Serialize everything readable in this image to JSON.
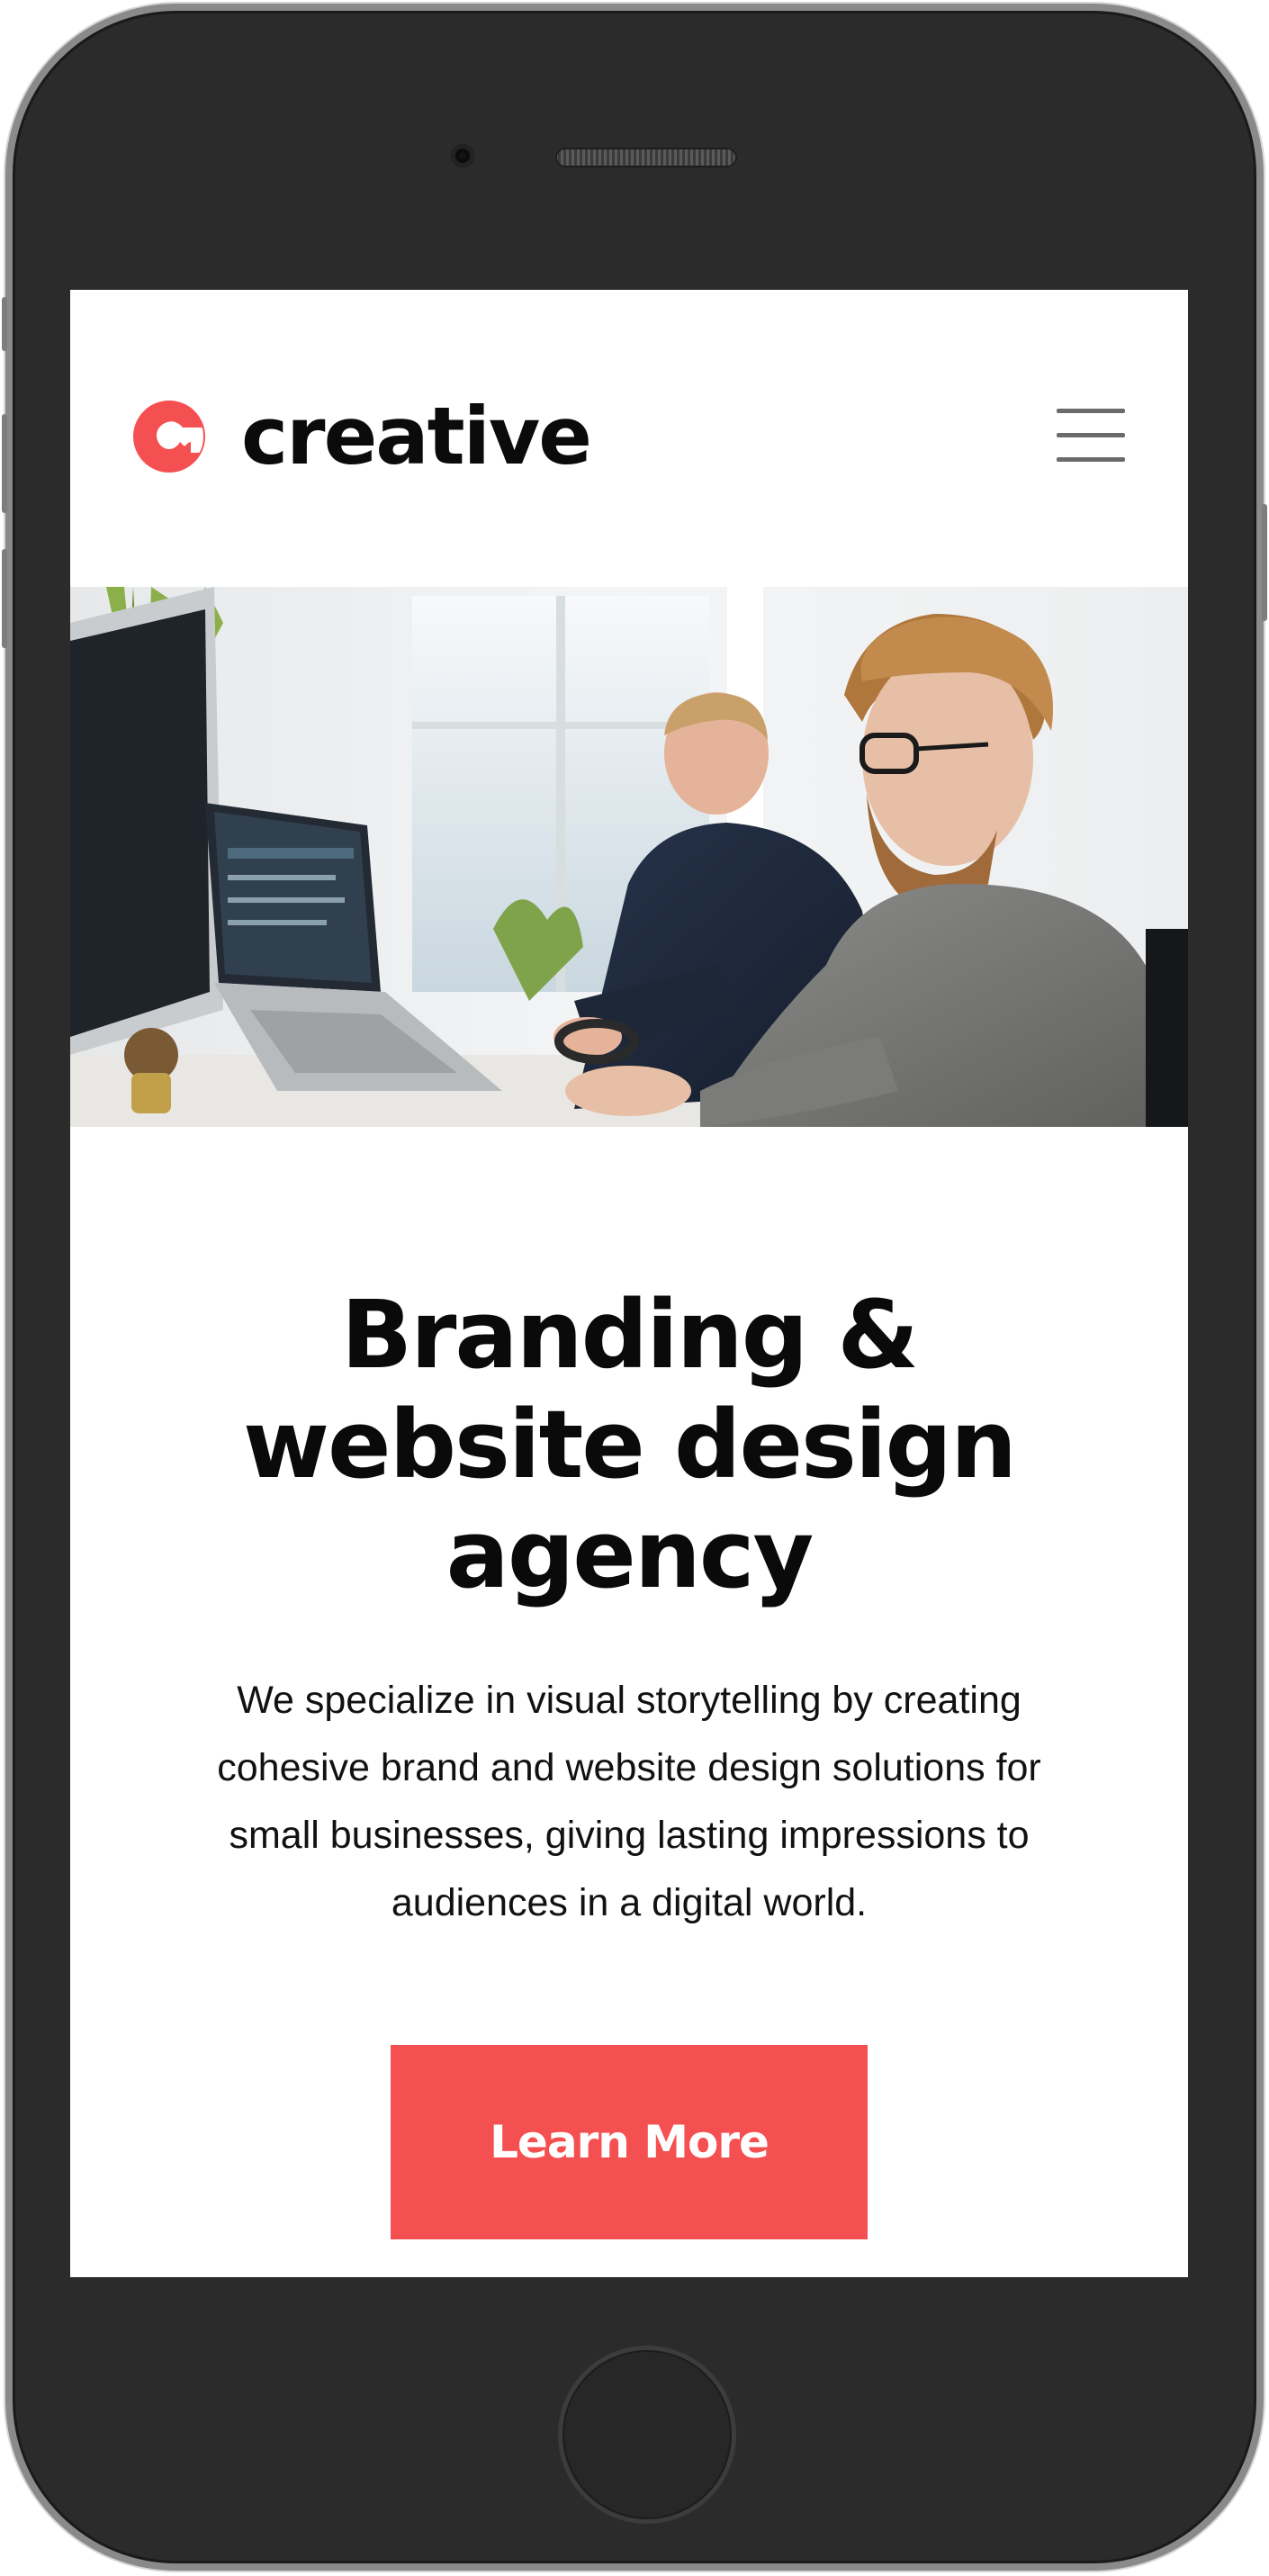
{
  "brand": {
    "name": "creative",
    "accent_color": "#f55051"
  },
  "header": {
    "logo_icon": "c-logo-icon",
    "menu_icon": "hamburger-menu-icon"
  },
  "hero": {
    "image": "office-workers-at-computers-photo"
  },
  "main": {
    "headline": "Branding & website design agency",
    "description": "We specialize in visual storytelling by creating cohesive brand and website design solutions for small businesses, giving lasting impressions to audiences in a digital world.",
    "cta_label": "Learn More"
  }
}
